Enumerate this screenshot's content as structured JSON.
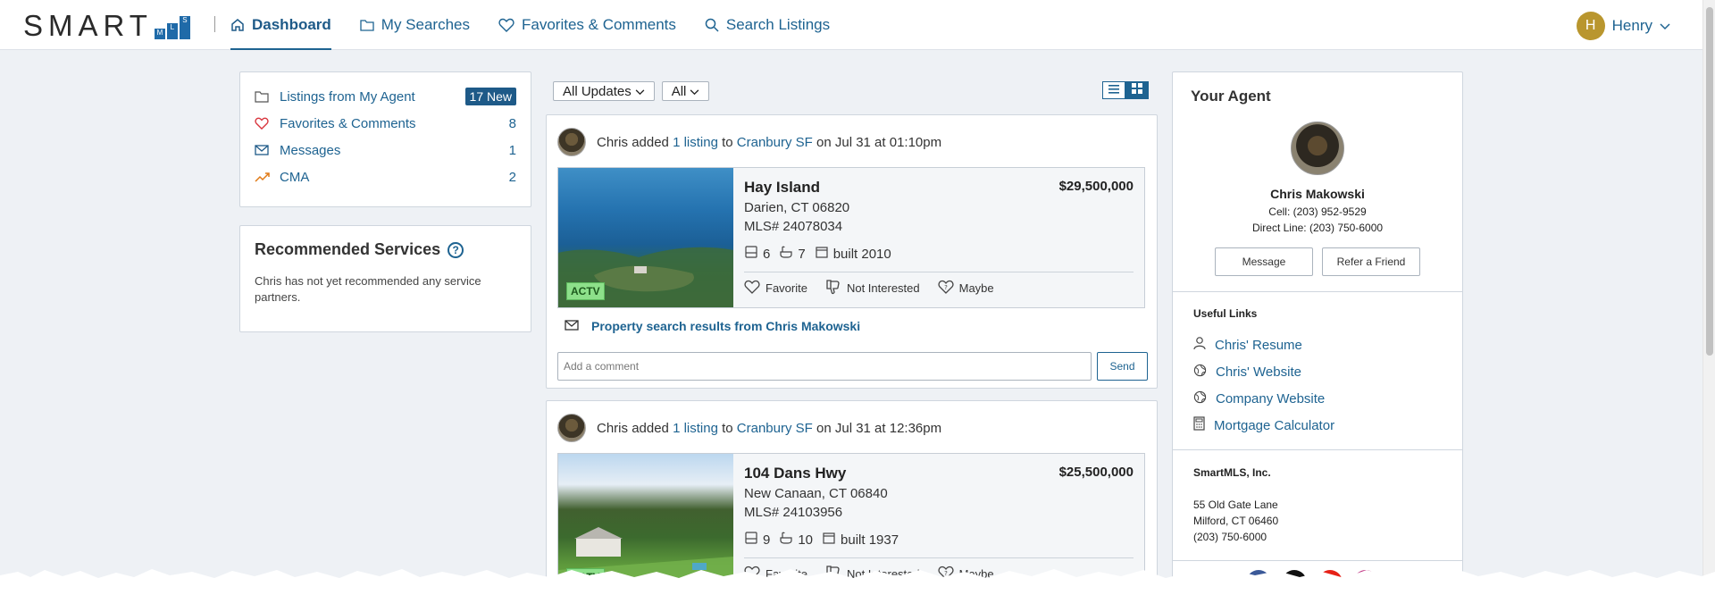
{
  "header": {
    "logo_text": "SMART",
    "logo_mls": [
      "M",
      "L",
      "S"
    ],
    "nav": [
      {
        "label": "Dashboard",
        "icon": "home-icon",
        "active": true
      },
      {
        "label": "My Searches",
        "icon": "folder-icon"
      },
      {
        "label": "Favorites & Comments",
        "icon": "heart-icon"
      },
      {
        "label": "Search Listings",
        "icon": "search-icon"
      }
    ],
    "user": {
      "initial": "H",
      "name": "Henry"
    }
  },
  "summary": [
    {
      "label": "Listings from My Agent",
      "count": "17 New",
      "icon": "folder-icon",
      "badge": true
    },
    {
      "label": "Favorites & Comments",
      "count": "8",
      "icon": "heart-icon"
    },
    {
      "label": "Messages",
      "count": "1",
      "icon": "mail-icon"
    },
    {
      "label": "CMA",
      "count": "2",
      "icon": "trend-up-icon"
    }
  ],
  "services": {
    "title": "Recommended Services",
    "help": "?",
    "text": "Chris has not yet recommended any service partners."
  },
  "filters": {
    "updates": "All Updates",
    "scope": "All"
  },
  "feed": [
    {
      "agent": "Chris",
      "verb": "added",
      "count_link": "1 listing",
      "to": "to",
      "search_link": "Cranbury SF",
      "when": "on Jul 31 at 01:10pm",
      "listing": {
        "title": "Hay Island",
        "price": "$29,500,000",
        "city": "Darien, CT 06820",
        "mls": "MLS# 24078034",
        "beds": "6",
        "baths": "7",
        "built": "built 2010",
        "status": "ACTV",
        "actions": [
          "Favorite",
          "Not Interested",
          "Maybe"
        ]
      },
      "message": "Property search results from Chris Makowski",
      "comment_placeholder": "Add a comment",
      "send": "Send"
    },
    {
      "agent": "Chris",
      "verb": "added",
      "count_link": "1 listing",
      "to": "to",
      "search_link": "Cranbury SF",
      "when": "on Jul 31 at 12:36pm",
      "listing": {
        "title": "104 Dans Hwy",
        "price": "$25,500,000",
        "city": "New Canaan, CT 06840",
        "mls": "MLS# 24103956",
        "beds": "9",
        "baths": "10",
        "built": "built 1937",
        "status": "ACTV",
        "actions": [
          "Favorite",
          "Not Interested",
          "Maybe"
        ]
      }
    }
  ],
  "agent": {
    "title": "Your Agent",
    "name": "Chris Makowski",
    "cell": "Cell: (203) 952-9529",
    "direct": "Direct Line: (203) 750-6000",
    "message_btn": "Message",
    "refer_btn": "Refer a Friend",
    "useful_links_title": "Useful Links",
    "links": [
      {
        "label": "Chris' Resume",
        "icon": "person-icon"
      },
      {
        "label": "Chris' Website",
        "icon": "globe-icon"
      },
      {
        "label": "Company Website",
        "icon": "globe-icon"
      },
      {
        "label": "Mortgage Calculator",
        "icon": "calculator-icon"
      }
    ],
    "company": "SmartMLS, Inc.",
    "address1": "55 Old Gate Lane",
    "address2": "Milford, CT 06460",
    "phone": "(203) 750-6000",
    "socials": [
      {
        "name": "facebook-icon",
        "color": "#3b5998"
      },
      {
        "name": "x-icon",
        "color": "#111111"
      },
      {
        "name": "youtube-icon",
        "color": "#e62117"
      },
      {
        "name": "instagram-icon",
        "color": "#c13584"
      }
    ]
  }
}
